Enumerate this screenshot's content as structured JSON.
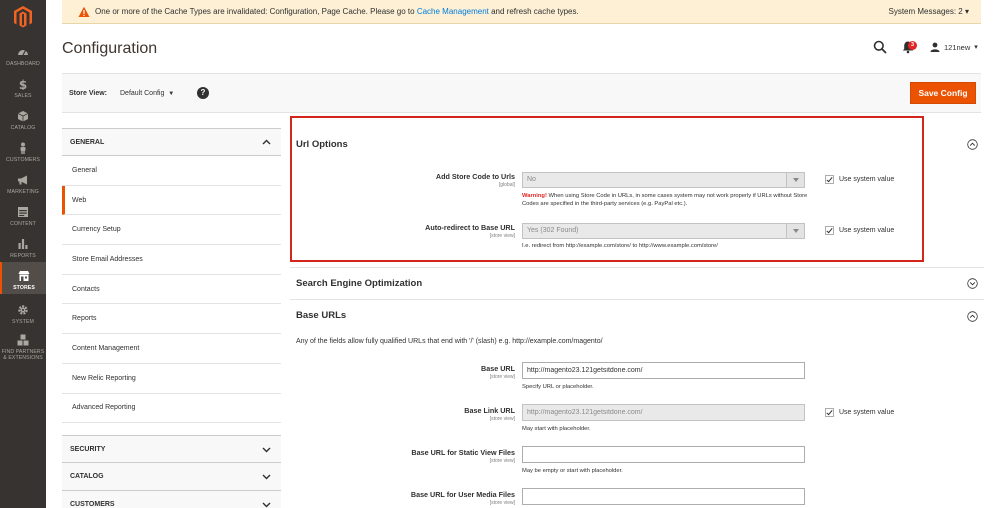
{
  "nav": {
    "items": [
      {
        "label": "Dashboard",
        "icon": "dashboard-icon"
      },
      {
        "label": "Sales",
        "icon": "dollar-icon"
      },
      {
        "label": "Catalog",
        "icon": "box-icon"
      },
      {
        "label": "Customers",
        "icon": "person-icon"
      },
      {
        "label": "Marketing",
        "icon": "megaphone-icon"
      },
      {
        "label": "Content",
        "icon": "layout-icon"
      },
      {
        "label": "Reports",
        "icon": "bar-chart-icon"
      },
      {
        "label": "Stores",
        "icon": "storefront-icon"
      },
      {
        "label": "System",
        "icon": "gear-icon"
      },
      {
        "label": "Find Partners & Extensions",
        "icon": "cubes-icon"
      }
    ],
    "active": "Stores",
    "accent": "#eb5202",
    "background": "#373330"
  },
  "message": {
    "text_before": "One or more of the Cache Types are invalidated: Configuration, Page Cache. Please go to ",
    "link": "Cache Management",
    "text_after": " and refresh cache types.",
    "system_messages": "System Messages: 2"
  },
  "header": {
    "title": "Configuration",
    "notifications_count": "3",
    "user": "121new"
  },
  "store_view": {
    "label": "Store View:",
    "value": "Default Config",
    "help": "?"
  },
  "actions": {
    "save": "Save Config"
  },
  "tabs": {
    "general": {
      "title": "General",
      "items": [
        "General",
        "Web",
        "Currency Setup",
        "Store Email Addresses",
        "Contacts",
        "Reports",
        "Content Management",
        "New Relic Reporting",
        "Advanced Reporting"
      ],
      "active": "Web"
    },
    "collapsed": [
      "Security",
      "Catalog",
      "Customers"
    ]
  },
  "sections": {
    "url_options": {
      "title": "Url Options",
      "fields": {
        "store_code": {
          "label": "Add Store Code to Urls",
          "scope": "[global]",
          "value": "No",
          "warning_label": "Warning!",
          "warning_text": " When using Store Code in URLs, in some cases system may not work properly if URLs without Store Codes are specified in the third-party services (e.g. PayPal etc.).",
          "use_system": "Use system value"
        },
        "auto_redirect": {
          "label": "Auto-redirect to Base URL",
          "scope": "[store view]",
          "value": "Yes (302 Found)",
          "note": "I.e. redirect from http://example.com/store/ to http://www.example.com/store/",
          "use_system": "Use system value"
        }
      }
    },
    "seo": {
      "title": "Search Engine Optimization"
    },
    "base_urls": {
      "title": "Base URLs",
      "description": "Any of the fields allow fully qualified URLs that end with '/' (slash) e.g. http://example.com/magento/",
      "fields": {
        "base_url": {
          "label": "Base URL",
          "scope": "[store view]",
          "value": "http://magento23.121getsitdone.com/",
          "note": "Specify URL or placeholder."
        },
        "base_link_url": {
          "label": "Base Link URL",
          "scope": "[store view]",
          "value": "http://magento23.121getsitdone.com/",
          "note": "May start with placeholder.",
          "use_system": "Use system value"
        },
        "static_view": {
          "label": "Base URL for Static View Files",
          "scope": "[store view]",
          "value": "",
          "note": "May be empty or start with placeholder."
        },
        "user_media": {
          "label": "Base URL for User Media Files",
          "scope": "[store view]",
          "value": ""
        }
      }
    }
  }
}
